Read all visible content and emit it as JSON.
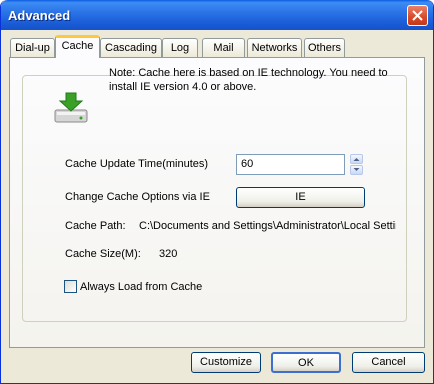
{
  "window": {
    "title": "Advanced"
  },
  "tabs": [
    "Dial-up",
    "Cache",
    "Cascading",
    "Log",
    "Mail",
    "Networks",
    "Others"
  ],
  "active_tab": "Cache",
  "note": "Note: Cache here is based on IE technology. You need to install IE version 4.0 or above.",
  "fields": {
    "update_time_label": "Cache Update Time(minutes)",
    "update_time_value": "60",
    "change_options_label": "Change Cache Options via IE",
    "ie_button": "IE",
    "path_label": "Cache Path:",
    "path_value": "C:\\Documents and Settings\\Administrator\\Local Settings",
    "size_label": "Cache Size(M):",
    "size_value": "320",
    "always_load_label": "Always Load from Cache",
    "always_load_checked": false
  },
  "buttons": {
    "customize": "Customize",
    "ok": "OK",
    "cancel": "Cancel"
  },
  "icons": {
    "title_close": "close-icon",
    "cache": "download-drive-icon"
  },
  "colors": {
    "title_bar": "#2b74e8",
    "tab_highlight": "#ffc83c",
    "icon_green": "#3aa028"
  }
}
